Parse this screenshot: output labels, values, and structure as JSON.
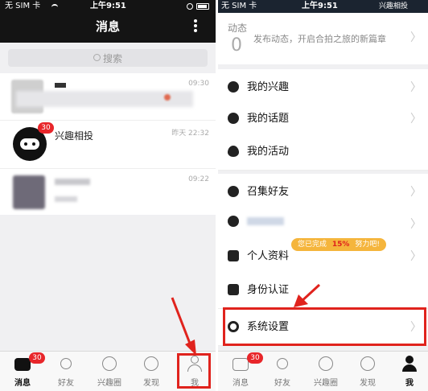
{
  "left": {
    "status": {
      "carrier": "无 SIM 卡",
      "time": "上午9:51"
    },
    "header": {
      "title": "消息",
      "menu_icon": "more-vertical-icon"
    },
    "search": {
      "label": "搜索"
    },
    "conversations": [
      {
        "name": "",
        "preview": "",
        "time": "09:30",
        "blurred": true
      },
      {
        "name": "兴趣相投",
        "preview": "",
        "time": "昨天 22:32",
        "badge": "30",
        "blurred": false
      },
      {
        "name": "",
        "preview": "",
        "time": "09:22",
        "blurred": true
      }
    ],
    "tabs": [
      {
        "label": "消息",
        "icon": "message-icon",
        "active": true,
        "badge": "30"
      },
      {
        "label": "好友",
        "icon": "friends-icon",
        "active": false
      },
      {
        "label": "兴趣圈",
        "icon": "circle-icon",
        "active": false
      },
      {
        "label": "发现",
        "icon": "compass-icon",
        "active": false
      },
      {
        "label": "我",
        "icon": "person-icon",
        "active": false
      }
    ]
  },
  "right": {
    "status": {
      "carrier": "无 SIM 卡",
      "time": "上午9:51",
      "app_label": "兴趣相投"
    },
    "dynamics": {
      "label": "动态",
      "count": "0",
      "prompt": "发布动态，开启合拍之旅的新篇章"
    },
    "menu_groups": [
      [
        {
          "label": "我的兴趣",
          "icon": "interest-icon"
        },
        {
          "label": "我的话题",
          "icon": "topic-icon"
        },
        {
          "label": "我的活动",
          "icon": "heart-icon"
        }
      ],
      [
        {
          "label": "召集好友",
          "icon": "bell-icon"
        },
        {
          "label": "",
          "icon": "user-icon"
        },
        {
          "label": "个人资料",
          "icon": "profile-icon"
        },
        {
          "label": "身份认证",
          "icon": "id-card-icon"
        },
        {
          "label": "系统设置",
          "icon": "settings-icon"
        }
      ]
    ],
    "profile_tip": {
      "prefix": "您已完成",
      "percent": "15%",
      "suffix": "努力吧!"
    },
    "tabs": [
      {
        "label": "消息",
        "icon": "message-icon",
        "active": false,
        "badge": "30"
      },
      {
        "label": "好友",
        "icon": "friends-icon",
        "active": false
      },
      {
        "label": "兴趣圈",
        "icon": "circle-icon",
        "active": false
      },
      {
        "label": "发现",
        "icon": "compass-icon",
        "active": false
      },
      {
        "label": "我",
        "icon": "person-icon",
        "active": true
      }
    ]
  },
  "colors": {
    "accent_red": "#e0231d",
    "badge_red": "#e8262a",
    "tip_orange": "#f5b53c",
    "dark_header": "#141414"
  }
}
